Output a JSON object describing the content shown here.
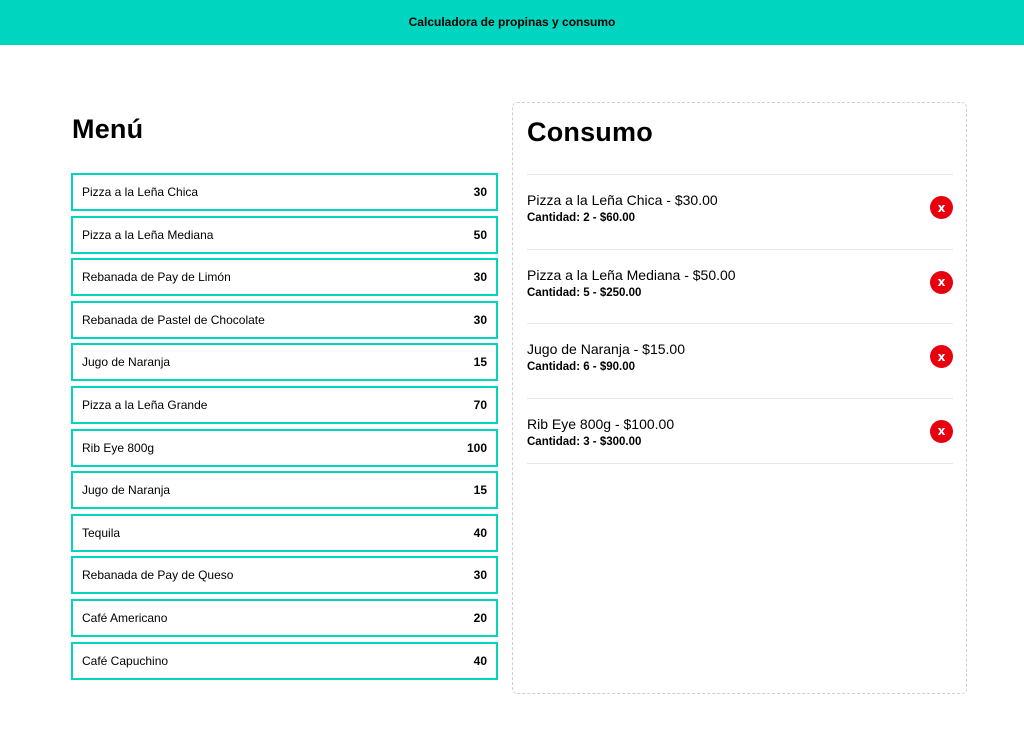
{
  "header": {
    "title": "Calculadora de propinas y consumo"
  },
  "menu": {
    "heading": "Menú",
    "items": [
      {
        "name": "Pizza a la Leña Chica",
        "price": "30"
      },
      {
        "name": "Pizza a la Leña Mediana",
        "price": "50"
      },
      {
        "name": "Rebanada de Pay de Limón",
        "price": "30"
      },
      {
        "name": "Rebanada de Pastel de Chocolate",
        "price": "30"
      },
      {
        "name": "Jugo de Naranja",
        "price": "15"
      },
      {
        "name": "Pizza a la Leña Grande",
        "price": "70"
      },
      {
        "name": "Rib Eye 800g",
        "price": "100"
      },
      {
        "name": "Jugo de Naranja",
        "price": "15"
      },
      {
        "name": "Tequila",
        "price": "40"
      },
      {
        "name": "Rebanada de Pay de Queso",
        "price": "30"
      },
      {
        "name": "Café Americano",
        "price": "20"
      },
      {
        "name": "Café Capuchino",
        "price": "40"
      }
    ]
  },
  "consumo": {
    "heading": "Consumo",
    "remove_label": "x",
    "items": [
      {
        "title": "Pizza a la Leña Chica - $30.00",
        "quantity": "Cantidad: 2 - $60.00"
      },
      {
        "title": "Pizza a la Leña Mediana - $50.00",
        "quantity": "Cantidad: 5 - $250.00"
      },
      {
        "title": "Jugo de Naranja - $15.00",
        "quantity": "Cantidad: 6 - $90.00"
      },
      {
        "title": "Rib Eye 800g - $100.00",
        "quantity": "Cantidad: 3 - $300.00"
      }
    ]
  },
  "colors": {
    "accent": "#00d5c0",
    "remove": "#e8000f"
  }
}
